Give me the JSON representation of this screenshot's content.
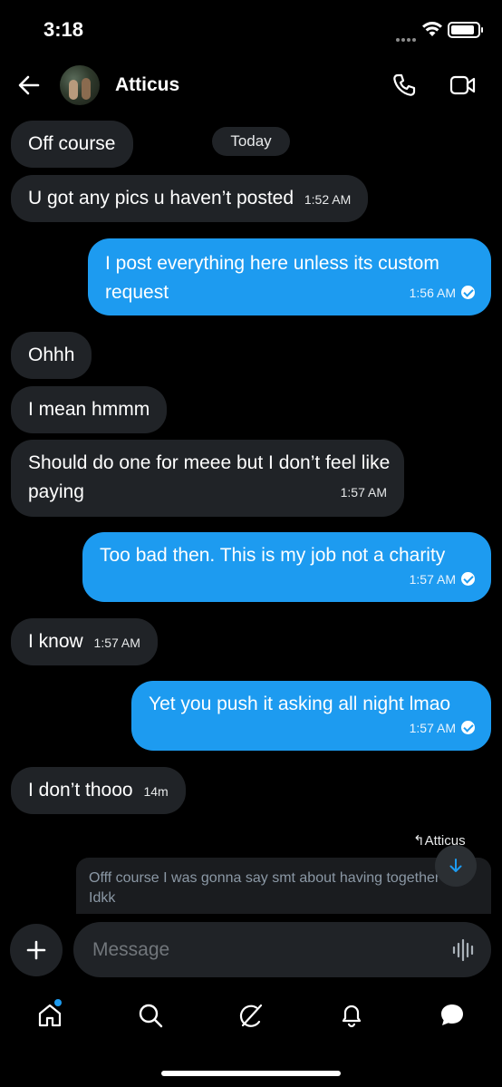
{
  "status": {
    "time": "3:18"
  },
  "header": {
    "contact_name": "Atticus"
  },
  "date_divider": "Today",
  "messages": [
    {
      "text": "Off course"
    },
    {
      "text": "U got any pics u haven’t posted",
      "time": "1:52 AM"
    },
    {
      "text": "I post everything here unless its custom request",
      "time": "1:56 AM"
    },
    {
      "text": "Ohhh"
    },
    {
      "text": "I mean hmmm"
    },
    {
      "text": "Should do one for meee but I don’t feel like paying",
      "time": "1:57 AM"
    },
    {
      "text": "Too bad then. This is my job not a charity",
      "time": "1:57 AM"
    },
    {
      "text": "I know",
      "time": "1:57 AM"
    },
    {
      "text": "Yet you push it asking all night lmao",
      "time": "1:57 AM"
    },
    {
      "text": "I don’t thooo",
      "time": "14m"
    }
  ],
  "reply": {
    "label": "Atticus",
    "quote": "Offf course I was gonna say smt about having together butt Idkk"
  },
  "composer": {
    "placeholder": "Message"
  },
  "colors": {
    "accent": "#1d9bf0",
    "bubble_received": "#202327",
    "background": "#000000"
  },
  "icons": [
    "back-arrow-icon",
    "phone-icon",
    "video-icon",
    "scroll-down-arrow-icon",
    "plus-icon",
    "voice-waveform-icon",
    "home-icon",
    "search-icon",
    "grok-icon",
    "bell-icon",
    "messages-icon"
  ]
}
